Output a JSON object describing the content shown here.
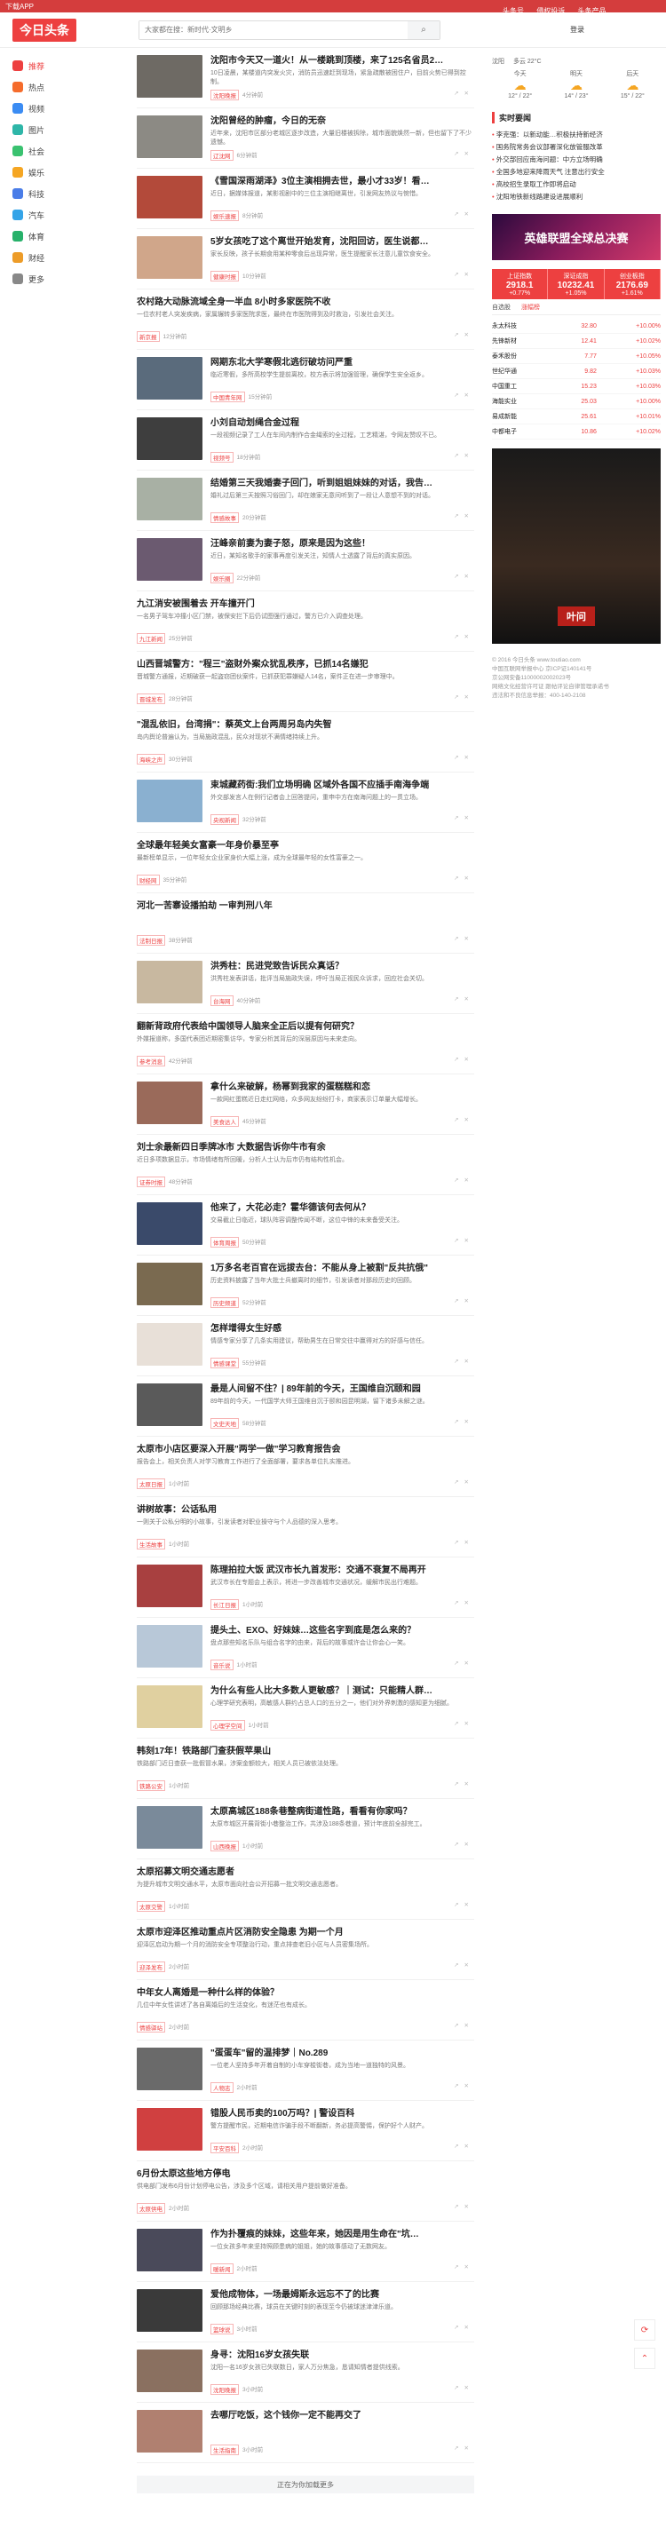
{
  "topbar": {
    "left": "下载APP",
    "login": "头条号",
    "links": [
      "侵权投诉",
      "头条产品"
    ]
  },
  "header": {
    "logo": "今日头条",
    "search_placeholder": "大家都在搜：新时代·文明乡",
    "login": "登录"
  },
  "nav": [
    {
      "label": "推荐",
      "icon": "home-icon",
      "color": "#ed4040"
    },
    {
      "label": "热点",
      "icon": "fire-icon",
      "color": "#f56c2c"
    },
    {
      "label": "视频",
      "icon": "video-icon",
      "color": "#3b8cf3"
    },
    {
      "label": "图片",
      "icon": "image-icon",
      "color": "#2eb6a8"
    },
    {
      "label": "社会",
      "icon": "flag-icon",
      "color": "#3ac270"
    },
    {
      "label": "娱乐",
      "icon": "star-icon",
      "color": "#f5a623"
    },
    {
      "label": "科技",
      "icon": "chip-icon",
      "color": "#4a7de8"
    },
    {
      "label": "汽车",
      "icon": "car-icon",
      "color": "#34a4e8"
    },
    {
      "label": "体育",
      "icon": "ball-icon",
      "color": "#27b16a"
    },
    {
      "label": "财经",
      "icon": "money-icon",
      "color": "#ed9c28"
    },
    {
      "label": "更多",
      "icon": "more-icon",
      "color": "#888"
    }
  ],
  "feed": [
    {
      "title": "沈阳市今天又一道火！从一楼跳到顶楼，来了125名省员2…",
      "desc": "10日凌晨，某楼道内突发火灾，消防员迅速赶到现场，紧急疏散被困住户，目前火势已得到控制。",
      "src": "沈阳晚报",
      "time": "4分钟前",
      "thumb": "#6e6a64",
      "img": true
    },
    {
      "title": "沈阳曾经的肿瘤，今日的无奈",
      "desc": "近年来，沈阳市区部分老城区逐步改造，大量旧楼被拆除，城市面貌焕然一新，但也留下了不少遗憾。",
      "src": "辽沈网",
      "time": "6分钟前",
      "thumb": "#8c8a84",
      "img": true
    },
    {
      "title": "《雪国深雨湖泽》3位主演相拥去世，最小才33岁！看…",
      "desc": "近日，据媒体报道，某影视剧中的三位主演相继离世，引发网友热议与惋惜。",
      "src": "娱乐速报",
      "time": "8分钟前",
      "thumb": "#b34a3a",
      "img": true
    },
    {
      "title": "5岁女孩吃了这个离世开始发育，沈阳回访，医生说都…",
      "desc": "家长反映，孩子长期食用某种零食后出现异常，医生提醒家长注意儿童饮食安全。",
      "src": "健康时报",
      "time": "10分钟前",
      "thumb": "#d0a68a",
      "img": true
    },
    {
      "title": "农村路大动脉流域全身一半血 8小时多家医院不收",
      "desc": "一位农村老人突发疾病，家属辗转多家医院求医，最终在市医院得到及时救治，引发社会关注。",
      "src": "新京报",
      "time": "12分钟前",
      "thumb": "",
      "img": false
    },
    {
      "title": "网期东北大学寒假北逃衍破坊问严重",
      "desc": "临近寒假，多所高校学生提前离校，校方表示将加强管理，确保学生安全返乡。",
      "src": "中国青年网",
      "time": "15分钟前",
      "thumb": "#5a6b7c",
      "img": true
    },
    {
      "title": "小刘自动划绳合金过程",
      "desc": "一段视频记录了工人在车间内制作合金绳索的全过程，工艺精湛，令网友赞叹不已。",
      "src": "视频号",
      "time": "18分钟前",
      "thumb": "#3e3e3e",
      "img": true
    },
    {
      "title": "结婚第三天我婚妻子回门，听到姐姐妹妹的对话，我告…",
      "desc": "婚礼过后第三天按照习俗回门，却在娘家无意间听到了一段让人意想不到的对话。",
      "src": "情感故事",
      "time": "20分钟前",
      "thumb": "#a8b0a4",
      "img": true
    },
    {
      "title": "汪峰亲前妻为妻子怒，原来是因为这些！",
      "desc": "近日，某知名歌手的家事再度引发关注，知情人士透露了背后的真实原因。",
      "src": "娱乐圈",
      "time": "22分钟前",
      "thumb": "#6b5a70",
      "img": true
    },
    {
      "title": "九江消安被围着去 开车撞开门",
      "desc": "一名男子驾车冲撞小区门禁，被保安拦下后仍试图强行通过，警方已介入调查处理。",
      "src": "九江新闻",
      "time": "25分钟前",
      "thumb": "",
      "img": false
    },
    {
      "title": "山西晋城警方：\"程三\"盗财外案众犹乱秩序，已抓14名嫌犯",
      "desc": "晋城警方通报，近期破获一起盗窃团伙案件，已抓获犯罪嫌疑人14名，案件正在进一步审理中。",
      "src": "晋城发布",
      "time": "28分钟前",
      "thumb": "",
      "img": false
    },
    {
      "title": "\"混乱依旧，台湾捐\"：蔡英文上台两周另岛内失智",
      "desc": "岛内舆论普遍认为，当局施政混乱，民众对现状不满情绪持续上升。",
      "src": "海峡之声",
      "time": "30分钟前",
      "thumb": "",
      "img": false
    },
    {
      "title": "束城藏药街:我们立场明确 区域外各国不应插手南海争端",
      "desc": "外交部发言人在例行记者会上回答提问，重申中方在南海问题上的一贯立场。",
      "src": "央视新闻",
      "time": "32分钟前",
      "thumb": "#8ab0d0",
      "img": true
    },
    {
      "title": "全球最年轻美女富豪一年身价暴至亭",
      "desc": "最新榜单显示，一位年轻女企业家身价大幅上涨，成为全球最年轻的女性富豪之一。",
      "src": "财经网",
      "time": "35分钟前",
      "thumb": "",
      "img": false
    },
    {
      "title": "河北一苦寨设播拍劫 一审判刑八年",
      "desc": "",
      "src": "法制日报",
      "time": "38分钟前",
      "thumb": "",
      "img": false
    },
    {
      "title": "洪秀柱：民进党致告诉民众真话？",
      "desc": "洪秀柱发表讲话，批评当局施政失误，呼吁当局正视民众诉求，回应社会关切。",
      "src": "台海网",
      "time": "40分钟前",
      "thumb": "#c8b8a0",
      "img": true
    },
    {
      "title": "翻新背政府代表给中国领导人脑来全正后以提有何研究？",
      "desc": "外媒报道称，多国代表团近期密集访华，专家分析其背后的深层原因与未来走向。",
      "src": "参考消息",
      "time": "42分钟前",
      "thumb": "",
      "img": false
    },
    {
      "title": "拿什么来破解，杨幂到我家的蛋糕糕和恋",
      "desc": "一款网红蛋糕近日走红网络，众多网友纷纷打卡，商家表示订单量大幅增长。",
      "src": "美食达人",
      "time": "45分钟前",
      "thumb": "#9a6a5a",
      "img": true
    },
    {
      "title": "刘士余最新四日季牌冰市 大数据告诉你牛市有余",
      "desc": "近日多项数据显示，市场情绪有所回暖，分析人士认为后市仍有结构性机会。",
      "src": "证券时报",
      "time": "48分钟前",
      "thumb": "",
      "img": false
    },
    {
      "title": "他来了，大花必走？霍华德该何去何从？",
      "desc": "交易截止日临近，球队阵容调整传闻不断，这位中锋的未来备受关注。",
      "src": "体育周报",
      "time": "50分钟前",
      "thumb": "#3a4a6a",
      "img": true
    },
    {
      "title": "1万多名老百官在远拔去台：不能从身上被割\"反共抗俄\"",
      "desc": "历史资料披露了当年大批士兵撤离时的细节，引发读者对那段历史的回顾。",
      "src": "历史频道",
      "time": "52分钟前",
      "thumb": "#7a6a50",
      "img": true
    },
    {
      "title": "怎样增得女生好感",
      "desc": "情感专家分享了几条实用建议，帮助男生在日常交往中赢得对方的好感与信任。",
      "src": "情感课堂",
      "time": "55分钟前",
      "thumb": "#e8e0d8",
      "img": true
    },
    {
      "title": "最是人间留不住？| 89年前的今天，王国维自沉颐和园",
      "desc": "89年前的今天，一代国学大师王国维自沉于颐和园昆明湖，留下诸多未解之谜。",
      "src": "文史天地",
      "time": "58分钟前",
      "thumb": "#5a5a5a",
      "img": true
    },
    {
      "title": "太原市小店区要深入开展\"两学一做\"学习教育报告会",
      "desc": "报告会上，相关负责人对学习教育工作进行了全面部署，要求各单位扎实推进。",
      "src": "太原日报",
      "time": "1小时前",
      "thumb": "",
      "img": false
    },
    {
      "title": "讲树故事：公话私用",
      "desc": "一则关于公私分明的小故事，引发读者对职业操守与个人品德的深入思考。",
      "src": "生活故事",
      "time": "1小时前",
      "thumb": "",
      "img": false
    },
    {
      "title": "陈理拍拉大饭 武汉市长九首发形：交通不衰复不局再开",
      "desc": "武汉市长在专题会上表示，将进一步改善城市交通状况，缓解市民出行难题。",
      "src": "长江日报",
      "time": "1小时前",
      "thumb": "#a84040",
      "img": true
    },
    {
      "title": "提头土、EXO、好妹妹…这些名字到底是怎么来的？",
      "desc": "盘点那些知名乐队与组合名字的由来，背后的故事或许会让你会心一笑。",
      "src": "音乐说",
      "time": "1小时前",
      "thumb": "#b8c8d8",
      "img": true
    },
    {
      "title": "为什么有些人比大多数人更敏感？｜测试：只能精人群…",
      "desc": "心理学研究表明，高敏感人群约占总人口的五分之一，他们对外界刺激的感知更为细腻。",
      "src": "心理学空间",
      "time": "1小时前",
      "thumb": "#e0d0a0",
      "img": true
    },
    {
      "title": "韩刻17年！铁路部门查获假苹果山",
      "desc": "铁路部门近日查获一批假冒水果，涉案金额较大，相关人员已被依法处理。",
      "src": "铁路公安",
      "time": "1小时前",
      "thumb": "",
      "img": false
    },
    {
      "title": "太原高城区188条巷整病街道性路，看看有你家吗？",
      "desc": "太原市城区开展背街小巷整治工作，共涉及188条巷道，预计年底前全部完工。",
      "src": "山西晚报",
      "time": "1小时前",
      "thumb": "#7a8a9a",
      "img": true
    },
    {
      "title": "太原招募文明交通志愿者",
      "desc": "为提升城市文明交通水平，太原市面向社会公开招募一批文明交通志愿者。",
      "src": "太原交警",
      "time": "1小时前",
      "thumb": "",
      "img": false
    },
    {
      "title": "太原市迎泽区推动重点片区消防安全隐患 为期一个月",
      "desc": "迎泽区启动为期一个月的消防安全专项整治行动，重点排查老旧小区与人员密集场所。",
      "src": "迎泽发布",
      "time": "2小时前",
      "thumb": "",
      "img": false
    },
    {
      "title": "中年女人离婚是一种什么样的体验？",
      "desc": "几位中年女性讲述了各自离婚后的生活变化，有迷茫也有成长。",
      "src": "情感驿站",
      "time": "2小时前",
      "thumb": "",
      "img": false
    },
    {
      "title": "\"蛋蛋车\"留的温排梦｜No.289",
      "desc": "一位老人坚持多年开着自制的小车穿梭街巷，成为当地一道独特的风景。",
      "src": "人物志",
      "time": "2小时前",
      "thumb": "#6a6a6a",
      "img": true
    },
    {
      "title": "错股人民币卖的100万吗？| 警设百科",
      "desc": "警方提醒市民，近期电信诈骗手段不断翻新，务必提高警惕，保护好个人财产。",
      "src": "平安百科",
      "time": "2小时前",
      "thumb": "#d04040",
      "img": true
    },
    {
      "title": "6月份太原这些地方停电",
      "desc": "供电部门发布6月份计划停电公告，涉及多个区域，请相关用户提前做好准备。",
      "src": "太原供电",
      "time": "2小时前",
      "thumb": "",
      "img": false
    },
    {
      "title": "作为扑覆痕的妹妹，这些年来，她因是用生命在\"坑…",
      "desc": "一位女孩多年来坚持照顾患病的姐姐，她的故事感动了无数网友。",
      "src": "暖新闻",
      "time": "2小时前",
      "thumb": "#4a4a5a",
      "img": true
    },
    {
      "title": "爱他成物体，一场最姆斯永远忘不了的比赛",
      "desc": "回顾那场经典比赛，球员在关键时刻的表现至今仍被球迷津津乐道。",
      "src": "篮球说",
      "time": "3小时前",
      "thumb": "#3a3a3a",
      "img": true
    },
    {
      "title": "身寻：沈阳16岁女孩失联",
      "desc": "沈阳一名16岁女孩已失联数日，家人万分焦急，恳请知情者提供线索。",
      "src": "沈阳晚报",
      "time": "3小时前",
      "thumb": "#8a7060",
      "img": true
    },
    {
      "title": "去哪厅吃饭，这个钱你一定不能再交了",
      "desc": "",
      "src": "生活指南",
      "time": "3小时前",
      "thumb": "#b08070",
      "img": true
    }
  ],
  "weather": {
    "city": "沈阳",
    "now": "多云 22°C",
    "days": [
      {
        "label": "今天",
        "temp": "12° / 22°"
      },
      {
        "label": "明天",
        "temp": "14° / 23°"
      },
      {
        "label": "后天",
        "temp": "15° / 22°"
      }
    ]
  },
  "hot_title": "实时要闻",
  "hot": [
    "李克强：以新动能…积极扶持新经济",
    "国务院常务会议部署深化放管服改革",
    "外交部回应南海问题：中方立场明确",
    "全国多地迎来降雨天气 注意出行安全",
    "高校招生录取工作即将启动",
    "沈阳地铁新线路建设进展顺利"
  ],
  "ad": "英雄联盟全球总决赛",
  "stock": {
    "boxes": [
      {
        "name": "上证指数",
        "val": "2918.1",
        "chg": "+0.77%"
      },
      {
        "name": "深证成指",
        "val": "10232.41",
        "chg": "+1.05%"
      },
      {
        "name": "创业板指",
        "val": "2176.69",
        "chg": "+1.61%"
      }
    ],
    "tabs": [
      "自选股",
      "涨幅榜"
    ],
    "rows": [
      {
        "name": "永太科技",
        "price": "32.80",
        "chg": "+10.00%"
      },
      {
        "name": "先锋新材",
        "price": "12.41",
        "chg": "+10.02%"
      },
      {
        "name": "泰禾股份",
        "price": "7.77",
        "chg": "+10.05%"
      },
      {
        "name": "世纪华通",
        "price": "9.82",
        "chg": "+10.03%"
      },
      {
        "name": "中国重工",
        "price": "15.23",
        "chg": "+10.03%"
      },
      {
        "name": "海能实业",
        "price": "25.03",
        "chg": "+10.00%"
      },
      {
        "name": "易成新能",
        "price": "25.61",
        "chg": "+10.01%"
      },
      {
        "name": "中都电子",
        "price": "10.86",
        "chg": "+10.02%"
      }
    ]
  },
  "poster_label": "叶问",
  "footer": [
    "© 2016 今日头条 www.toutiao.com",
    "中国互联网举报中心 京ICP证140141号",
    "京公网安备11000002002023号",
    "网络文化经营许可证 跟帖评论自律管理承诺书",
    "违法和不良信息举报：400-140-2108"
  ],
  "load_more": "正在为你加载更多",
  "float_icons": [
    "refresh-icon",
    "back-to-top-icon"
  ]
}
